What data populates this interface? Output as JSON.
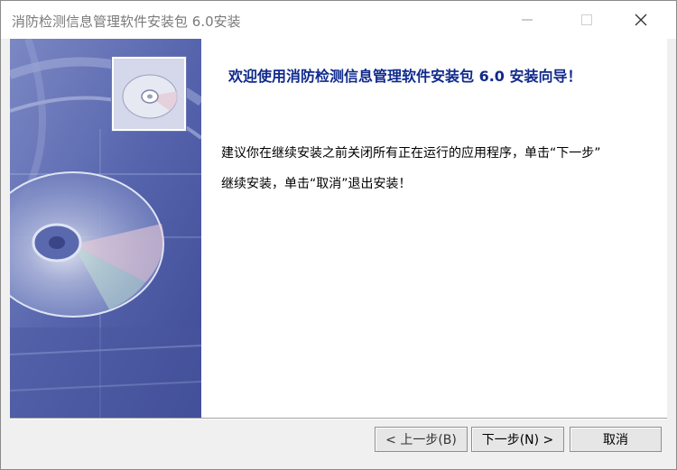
{
  "window": {
    "title": "消防检测信息管理软件安装包 6.0安装",
    "controls": {
      "minimize_icon": "minimize-icon",
      "maximize_icon": "maximize-icon",
      "close_icon": "close-icon"
    }
  },
  "content": {
    "welcome": "欢迎使用消防检测信息管理软件安装包 6.0 安装向导！",
    "description_lines": [
      "建议你在继续安装之前关闭所有正在运行的应用程序，单击“下一步”",
      "继续安装，单击“取消”退出安装！"
    ]
  },
  "buttons": {
    "back": "< 上一步(B)",
    "next": "下一步(N) >",
    "cancel": "取消"
  },
  "colors": {
    "welcome_text": "#102a8c",
    "banner_base": "#5f6fb4"
  }
}
